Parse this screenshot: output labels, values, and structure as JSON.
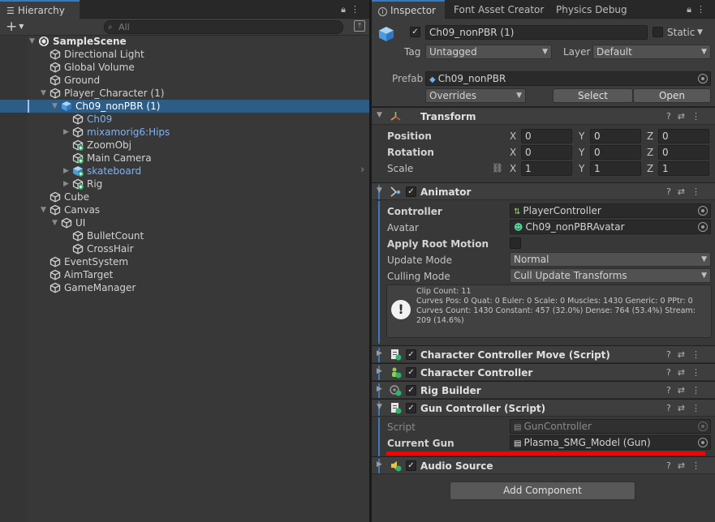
{
  "hierarchy": {
    "tab_label": "Hierarchy",
    "search_placeholder": "All",
    "items": [
      {
        "label": "SampleScene",
        "indent": 0,
        "fold": "open",
        "kind": "scene",
        "color": "normal"
      },
      {
        "label": "Directional Light",
        "indent": 1,
        "fold": "",
        "kind": "cube",
        "color": "normal"
      },
      {
        "label": "Global Volume",
        "indent": 1,
        "fold": "",
        "kind": "cube",
        "color": "normal"
      },
      {
        "label": "Ground",
        "indent": 1,
        "fold": "",
        "kind": "cube",
        "color": "normal"
      },
      {
        "label": "Player_Character (1)",
        "indent": 1,
        "fold": "open",
        "kind": "cube",
        "color": "normal"
      },
      {
        "label": "Ch09_nonPBR (1)",
        "indent": 2,
        "fold": "open",
        "kind": "cube-blue",
        "color": "normal",
        "selected": true
      },
      {
        "label": "Ch09",
        "indent": 3,
        "fold": "",
        "kind": "cube",
        "color": "blue"
      },
      {
        "label": "mixamorig6:Hips",
        "indent": 3,
        "fold": "closed",
        "kind": "cube",
        "color": "blue"
      },
      {
        "label": "ZoomObj",
        "indent": 3,
        "fold": "",
        "kind": "cube-plus",
        "color": "normal"
      },
      {
        "label": "Main Camera",
        "indent": 3,
        "fold": "",
        "kind": "cube-plus",
        "color": "normal"
      },
      {
        "label": "skateboard",
        "indent": 3,
        "fold": "closed",
        "kind": "cube-blue-plus",
        "color": "blue"
      },
      {
        "label": "Rig",
        "indent": 3,
        "fold": "closed",
        "kind": "cube-plus",
        "color": "normal"
      },
      {
        "label": "Cube",
        "indent": 1,
        "fold": "",
        "kind": "cube",
        "color": "normal"
      },
      {
        "label": "Canvas",
        "indent": 1,
        "fold": "open",
        "kind": "cube",
        "color": "normal"
      },
      {
        "label": "UI",
        "indent": 2,
        "fold": "open",
        "kind": "cube",
        "color": "normal"
      },
      {
        "label": "BulletCount",
        "indent": 3,
        "fold": "",
        "kind": "cube",
        "color": "normal"
      },
      {
        "label": "CrossHair",
        "indent": 3,
        "fold": "",
        "kind": "cube",
        "color": "normal"
      },
      {
        "label": "EventSystem",
        "indent": 1,
        "fold": "",
        "kind": "cube",
        "color": "normal"
      },
      {
        "label": "AimTarget",
        "indent": 1,
        "fold": "",
        "kind": "cube",
        "color": "normal"
      },
      {
        "label": "GameManager",
        "indent": 1,
        "fold": "",
        "kind": "cube",
        "color": "normal"
      }
    ]
  },
  "inspector": {
    "tabs": [
      "Inspector",
      "Font Asset Creator",
      "Physics Debug"
    ],
    "object": {
      "name": "Ch09_nonPBR (1)",
      "static_label": "Static",
      "tag_label": "Tag",
      "tag_value": "Untagged",
      "layer_label": "Layer",
      "layer_value": "Default",
      "prefab_label": "Prefab",
      "prefab_value": "Ch09_nonPBR",
      "overrides_label": "Overrides",
      "select_label": "Select",
      "open_label": "Open"
    },
    "transform": {
      "title": "Transform",
      "rows": [
        {
          "label": "Position",
          "x": "0",
          "y": "0",
          "z": "0"
        },
        {
          "label": "Rotation",
          "x": "0",
          "y": "0",
          "z": "0"
        },
        {
          "label": "Scale",
          "x": "1",
          "y": "1",
          "z": "1"
        }
      ],
      "axis": [
        "X",
        "Y",
        "Z"
      ]
    },
    "animator": {
      "title": "Animator",
      "controller_label": "Controller",
      "controller_value": "PlayerController",
      "avatar_label": "Avatar",
      "avatar_value": "Ch09_nonPBRAvatar",
      "apply_root_motion_label": "Apply Root Motion",
      "update_mode_label": "Update Mode",
      "update_mode_value": "Normal",
      "culling_mode_label": "Culling Mode",
      "culling_mode_value": "Cull Update Transforms",
      "info_lines": [
        "Clip Count: 11",
        "Curves Pos: 0 Quat: 0 Euler: 0 Scale: 0 Muscles: 1430 Generic: 0 PPtr: 0",
        "Curves Count: 1430 Constant: 457 (32.0%) Dense: 764 (53.4%) Stream:",
        "209 (14.6%)"
      ]
    },
    "components": [
      {
        "title": "Character Controller Move (Script)",
        "expanded": false
      },
      {
        "title": "Character Controller",
        "expanded": false
      },
      {
        "title": "Rig Builder",
        "expanded": false
      },
      {
        "title": "Gun Controller (Script)",
        "expanded": true
      },
      {
        "title": "Audio Source",
        "expanded": false
      }
    ],
    "gun_controller": {
      "script_label": "Script",
      "script_value": "GunController",
      "current_gun_label": "Current Gun",
      "current_gun_value": "Plasma_SMG_Model (Gun)"
    },
    "add_component_label": "Add Component",
    "accent_color": "#3a79bb",
    "highlight_color": "#ff0000"
  }
}
